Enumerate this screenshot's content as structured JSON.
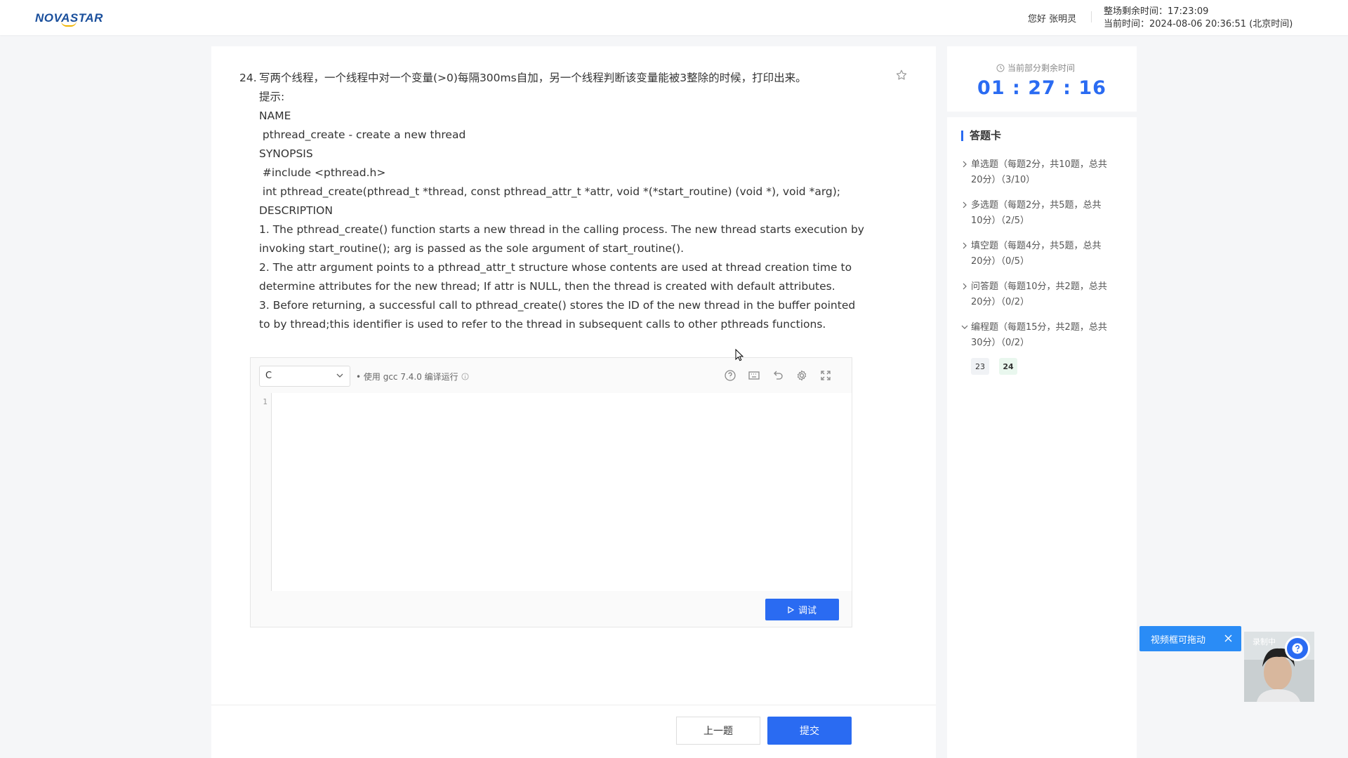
{
  "header": {
    "logo": "NOVASTAR",
    "greeting": "您好 张明灵",
    "exam_remaining": "整场剩余时间：17:23:09",
    "current_time": "当前时间：2024-08-06 20:36:51 (北京时间)"
  },
  "question": {
    "number": "24.",
    "title": "写两个线程，一个线程中对一个变量(>0)每隔300ms自加，另一个线程判断该变量能被3整除的时候，打印出来。",
    "lines": [
      "提示:",
      "NAME",
      " pthread_create - create a new thread",
      "SYNOPSIS",
      " #include <pthread.h>",
      " int pthread_create(pthread_t *thread, const pthread_attr_t *attr, void *(*start_routine) (void *), void *arg);",
      "DESCRIPTION"
    ],
    "para1": " 1. The  pthread_create()  function  starts  a  new  thread  in the calling process.  The new thread starts execution by invoking start_routine(); arg is passed as the sole argument of start_routine().",
    "para2": "2. The  attr  argument  points  to  a  pthread_attr_t  structure  whose  contents  are used at thread creation time to determine attributes for the new thread; If  attr  is NULL, then the thread is created with default attributes.",
    "para3": " 3. Before  returning,  a successful call to pthread_create() stores the ID of the new thread in the buffer pointed to by thread;this identifier is used to refer to the thread in subsequent calls to other pthreads functions."
  },
  "editor": {
    "language": "C",
    "compile_hint": "• 使用 gcc 7.4.0 编译运行",
    "line_number": "1",
    "debug_label": "调试"
  },
  "nav": {
    "prev_label": "上一题",
    "submit_label": "提交"
  },
  "sidebar": {
    "remain_label": "当前部分剩余时间",
    "remain_time": "01 : 27 : 16",
    "card_title": "答题卡",
    "sections": [
      {
        "line1": "单选题（每题2分，共10题，总共",
        "line2": "20分）（3/10）"
      },
      {
        "line1": "多选题（每题2分，共5题，总共",
        "line2": "10分）（2/5）"
      },
      {
        "line1": "填空题（每题4分，共5题，总共",
        "line2": "20分）（0/5）"
      },
      {
        "line1": "问答题（每题10分，共2题，总共",
        "line2": "20分）（0/2）"
      },
      {
        "line1": "编程题（每题15分，共2题，总共",
        "line2": "30分）（0/2）"
      }
    ],
    "question_numbers": [
      "23",
      "24"
    ]
  },
  "video": {
    "drag_tip": "视频框可拖动",
    "recording": "录制中"
  },
  "colors": {
    "accent": "#2a6bf2",
    "brand": "#1a4f9c",
    "tip": "#2a8cf6"
  }
}
